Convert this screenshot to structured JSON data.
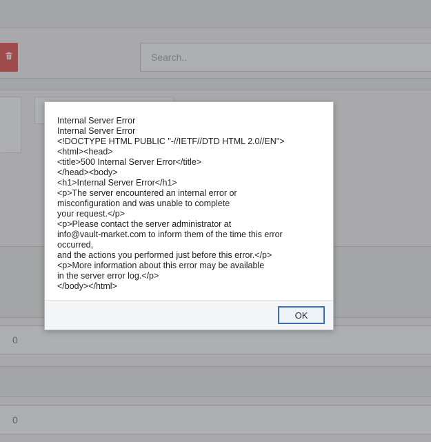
{
  "toolbar": {
    "trash_icon": "trash-icon",
    "search_placeholder": "Search.."
  },
  "inputs": {
    "numA": "0",
    "numB": "0"
  },
  "modal": {
    "lines": {
      "l1": "Internal Server Error",
      "l2": "Internal Server Error",
      "l3": "<!DOCTYPE HTML PUBLIC \"-//IETF//DTD HTML 2.0//EN\">",
      "l4": "<html><head>",
      "l5": "<title>500 Internal Server Error</title>",
      "l6": "</head><body>",
      "l7": "<h1>Internal Server Error</h1>",
      "l8": "<p>The server encountered an internal error or",
      "l9": "misconfiguration and was unable to complete",
      "l10": "your request.</p>",
      "l11": "<p>Please contact the server administrator at",
      "l12": " info@vault-market.com to inform them of the time this error occurred,",
      "l13": " and the actions you performed just before this error.</p>",
      "l14": "<p>More information about this error may be available",
      "l15": "in the server error log.</p>",
      "l16": "</body></html>"
    },
    "ok_label": "OK"
  }
}
